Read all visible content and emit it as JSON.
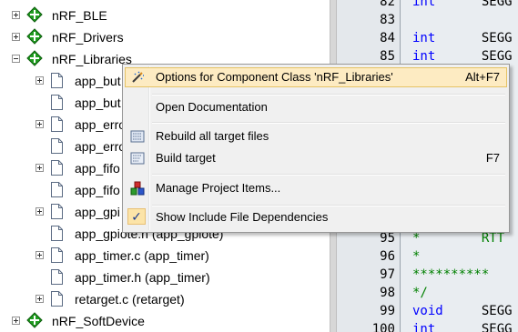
{
  "tree": {
    "groups_top": [
      {
        "label": "nRF_BLE",
        "expander": "plus"
      },
      {
        "label": "nRF_Drivers",
        "expander": "plus"
      },
      {
        "label": "nRF_Libraries",
        "expander": "minus"
      }
    ],
    "files": [
      {
        "label": "app_but",
        "expander": true
      },
      {
        "label": "app_but",
        "expander": false
      },
      {
        "label": "app_erro",
        "expander": true
      },
      {
        "label": "app_erro",
        "expander": false
      },
      {
        "label": "app_fifo",
        "expander": true
      },
      {
        "label": "app_fifo",
        "expander": false
      },
      {
        "label": "app_gpi",
        "expander": true
      },
      {
        "label": "app_gpiote.h (app_gpiote)",
        "expander": false
      },
      {
        "label": "app_timer.c (app_timer)",
        "expander": true
      },
      {
        "label": "app_timer.h (app_timer)",
        "expander": false
      },
      {
        "label": "retarget.c (retarget)",
        "expander": true
      }
    ],
    "group_bottom": {
      "label": "nRF_SoftDevice",
      "expander": "plus"
    }
  },
  "editor": {
    "lines": [
      {
        "num": "82",
        "code": "int      SEGG",
        "type": "kw"
      },
      {
        "num": "83",
        "code": "",
        "type": "plain"
      },
      {
        "num": "84",
        "code": "int      SEGG",
        "type": "kw"
      },
      {
        "num": "85",
        "code": "int      SEGG",
        "type": "kw"
      },
      {
        "num": "86",
        "code": "",
        "type": "plain"
      },
      {
        "num": "87",
        "code": "",
        "type": "plain"
      },
      {
        "num": "88",
        "code": "",
        "type": "plain"
      },
      {
        "num": "89",
        "code": "",
        "type": "plain"
      },
      {
        "num": "90",
        "code": "",
        "type": "plain"
      },
      {
        "num": "91",
        "code": "",
        "type": "plain"
      },
      {
        "num": "92",
        "code": "",
        "type": "plain"
      },
      {
        "num": "93",
        "code": "",
        "type": "plain"
      },
      {
        "num": "94",
        "code": "",
        "type": "plain"
      },
      {
        "num": "95",
        "code": "*        RTT",
        "type": "cm"
      },
      {
        "num": "96",
        "code": "*",
        "type": "cm"
      },
      {
        "num": "97",
        "code": "**********",
        "type": "cm"
      },
      {
        "num": "98",
        "code": "*/",
        "type": "cm"
      },
      {
        "num": "99",
        "code": "void     SEGG",
        "type": "kw"
      },
      {
        "num": "100",
        "code": "int      SEGG",
        "type": "kw"
      }
    ]
  },
  "menu": {
    "items": [
      {
        "label": "Options for Component Class 'nRF_Libraries'",
        "shortcut": "Alt+F7",
        "icon": "wand-icon"
      },
      {
        "label": "Open Documentation",
        "shortcut": "",
        "icon": ""
      },
      {
        "label": "Rebuild all target files",
        "shortcut": "",
        "icon": "rebuild-icon"
      },
      {
        "label": "Build target",
        "shortcut": "F7",
        "icon": "build-icon"
      },
      {
        "label": "Manage Project Items...",
        "shortcut": "",
        "icon": "manage-items-icon"
      },
      {
        "label": "Show Include File Dependencies",
        "shortcut": "",
        "icon": "checkmark-icon"
      }
    ]
  },
  "colors": {
    "highlight": "#fdebc2",
    "keyword": "#0000ff",
    "comment": "#008000",
    "group_diamond": "#1f9d1f"
  }
}
